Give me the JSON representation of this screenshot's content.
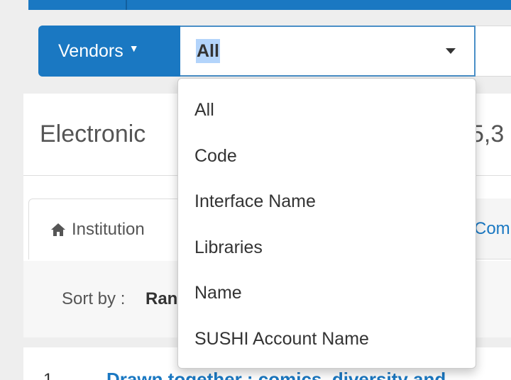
{
  "search": {
    "vendors_label": "Vendors",
    "scope_selected": "All"
  },
  "results": {
    "title": "Electronic",
    "count": "5,3"
  },
  "tabs": {
    "institution_label": "Institution",
    "community_label": "Commun"
  },
  "sort": {
    "label": "Sort by :",
    "value": "Rank"
  },
  "first_result": {
    "index": "1",
    "title": "Drawn together : comics, diversity and"
  },
  "dropdown": {
    "items": [
      "All",
      "Code",
      "Interface Name",
      "Libraries",
      "Name",
      "SUSHI Account Name"
    ]
  },
  "colors": {
    "brand": "#1a78c2",
    "selection": "#b3d4fb"
  },
  "icons": {
    "vendors_caret": "caret-down-icon",
    "select_caret": "chevron-down-icon",
    "tab_icon": "home-icon"
  }
}
